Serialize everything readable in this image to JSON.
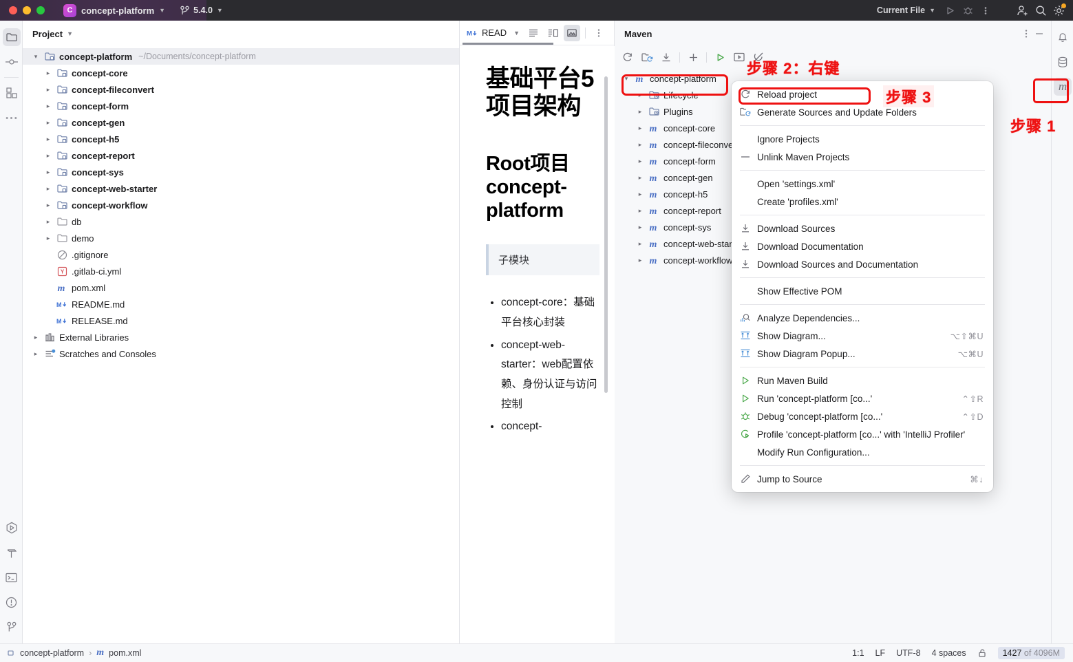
{
  "titlebar": {
    "project_name": "concept-platform",
    "project_badge": "C",
    "branch": "5.4.0",
    "run_config": "Current File",
    "icons": [
      "run-icon",
      "debug-icon",
      "more-options-icon",
      "add-user-icon",
      "search-icon",
      "settings-icon"
    ]
  },
  "left_activity_bar": {
    "items": [
      {
        "name": "project-tool-icon",
        "selected": true
      },
      {
        "name": "commit-tool-icon",
        "selected": false
      },
      {
        "name": "structure-tool-icon",
        "selected": false
      },
      {
        "name": "more-tools-icon",
        "selected": false
      }
    ],
    "bottom_items": [
      {
        "name": "run-tool-icon"
      },
      {
        "name": "build-tool-icon"
      },
      {
        "name": "terminal-tool-icon"
      },
      {
        "name": "problems-tool-icon"
      },
      {
        "name": "version-control-tool-icon"
      }
    ]
  },
  "project_panel": {
    "title": "Project",
    "tree": [
      {
        "label": "concept-platform",
        "path": "~/Documents/concept-platform",
        "icon": "module-folder-icon",
        "arrow": "open",
        "indent": 0,
        "bold": true,
        "selected": true
      },
      {
        "label": "concept-core",
        "icon": "module-folder-icon",
        "arrow": "closed",
        "indent": 1,
        "bold": true
      },
      {
        "label": "concept-fileconvert",
        "icon": "module-folder-icon",
        "arrow": "closed",
        "indent": 1,
        "bold": true
      },
      {
        "label": "concept-form",
        "icon": "module-folder-icon",
        "arrow": "closed",
        "indent": 1,
        "bold": true
      },
      {
        "label": "concept-gen",
        "icon": "module-folder-icon",
        "arrow": "closed",
        "indent": 1,
        "bold": true
      },
      {
        "label": "concept-h5",
        "icon": "module-folder-icon",
        "arrow": "closed",
        "indent": 1,
        "bold": true
      },
      {
        "label": "concept-report",
        "icon": "module-folder-icon",
        "arrow": "closed",
        "indent": 1,
        "bold": true
      },
      {
        "label": "concept-sys",
        "icon": "module-folder-icon",
        "arrow": "closed",
        "indent": 1,
        "bold": true
      },
      {
        "label": "concept-web-starter",
        "icon": "module-folder-icon",
        "arrow": "closed",
        "indent": 1,
        "bold": true
      },
      {
        "label": "concept-workflow",
        "icon": "module-folder-icon",
        "arrow": "closed",
        "indent": 1,
        "bold": true
      },
      {
        "label": "db",
        "icon": "folder-icon",
        "arrow": "closed",
        "indent": 1,
        "bold": false
      },
      {
        "label": "demo",
        "icon": "folder-icon",
        "arrow": "closed",
        "indent": 1,
        "bold": false
      },
      {
        "label": ".gitignore",
        "icon": "gitignore-icon",
        "arrow": "none",
        "indent": 1,
        "bold": false
      },
      {
        "label": ".gitlab-ci.yml",
        "icon": "yaml-icon",
        "arrow": "none",
        "indent": 1,
        "bold": false
      },
      {
        "label": "pom.xml",
        "icon": "maven-icon",
        "arrow": "none",
        "indent": 1,
        "bold": false
      },
      {
        "label": "README.md",
        "icon": "markdown-icon",
        "arrow": "none",
        "indent": 1,
        "bold": false
      },
      {
        "label": "RELEASE.md",
        "icon": "markdown-icon",
        "arrow": "none",
        "indent": 1,
        "bold": false
      },
      {
        "label": "External Libraries",
        "icon": "library-icon",
        "arrow": "closed",
        "indent": 0,
        "bold": false
      },
      {
        "label": "Scratches and Consoles",
        "icon": "scratches-icon",
        "arrow": "closed",
        "indent": 0,
        "bold": false
      }
    ]
  },
  "editor": {
    "tab_label": "READ",
    "tab_icon": "markdown-icon",
    "view_buttons": [
      {
        "name": "editor-only-view-button",
        "active": false
      },
      {
        "name": "split-view-button",
        "active": false
      },
      {
        "name": "preview-only-view-button",
        "active": true
      }
    ],
    "more_icon": "more-options-icon",
    "markdown": {
      "h1": "基础平台5项目架构",
      "h2": "Root项目 concept-platform",
      "quote": "子模块",
      "bullets": [
        "concept-core：基础平台核心封装",
        "concept-web-starter：web配置依赖、身份认证与访问控制",
        "concept-"
      ]
    }
  },
  "maven": {
    "title": "Maven",
    "header_icons": [
      "more-options-icon",
      "minimize-icon"
    ],
    "toolbar": [
      {
        "name": "reload-all-maven-projects-icon"
      },
      {
        "name": "generate-sources-icon"
      },
      {
        "name": "download-sources-icon"
      },
      {
        "name": "add-maven-project-icon"
      },
      {
        "name": "run-maven-build-icon"
      },
      {
        "name": "execute-maven-goal-icon"
      },
      {
        "name": "toggle-skip-tests-icon"
      }
    ],
    "tree": [
      {
        "label": "concept-platform",
        "icon": "maven-icon",
        "arrow": "open",
        "indent": 0,
        "highlighted": true
      },
      {
        "label": "Lifecycle",
        "icon": "maven-folder-icon",
        "arrow": "closed",
        "indent": 1
      },
      {
        "label": "Plugins",
        "icon": "maven-folder-icon",
        "arrow": "closed",
        "indent": 1
      },
      {
        "label": "concept-core",
        "icon": "maven-icon",
        "arrow": "closed",
        "indent": 1
      },
      {
        "label": "concept-fileconvert",
        "icon": "maven-icon",
        "arrow": "closed",
        "indent": 1
      },
      {
        "label": "concept-form",
        "icon": "maven-icon",
        "arrow": "closed",
        "indent": 1
      },
      {
        "label": "concept-gen",
        "icon": "maven-icon",
        "arrow": "closed",
        "indent": 1
      },
      {
        "label": "concept-h5",
        "icon": "maven-icon",
        "arrow": "closed",
        "indent": 1
      },
      {
        "label": "concept-report",
        "icon": "maven-icon",
        "arrow": "closed",
        "indent": 1
      },
      {
        "label": "concept-sys",
        "icon": "maven-icon",
        "arrow": "closed",
        "indent": 1
      },
      {
        "label": "concept-web-starter",
        "icon": "maven-icon",
        "arrow": "closed",
        "indent": 1
      },
      {
        "label": "concept-workflow",
        "icon": "maven-icon",
        "arrow": "closed",
        "indent": 1
      }
    ]
  },
  "right_activity_bar": {
    "items": [
      {
        "name": "notifications-icon",
        "selected": false
      },
      {
        "name": "database-icon",
        "selected": false
      },
      {
        "name": "maven-tool-icon",
        "selected": true
      }
    ]
  },
  "context_menu": {
    "items": [
      {
        "type": "item",
        "label": "Reload project",
        "icon": "reload-icon",
        "shortcut": "",
        "highlighted": true
      },
      {
        "type": "item",
        "label": "Generate Sources and Update Folders",
        "icon": "generate-sources-icon",
        "shortcut": ""
      },
      {
        "type": "separator"
      },
      {
        "type": "item",
        "label": "Ignore Projects",
        "icon": "",
        "shortcut": ""
      },
      {
        "type": "item",
        "label": "Unlink Maven Projects",
        "icon": "unlink-icon",
        "shortcut": ""
      },
      {
        "type": "separator"
      },
      {
        "type": "item",
        "label": "Open 'settings.xml'",
        "icon": "",
        "shortcut": ""
      },
      {
        "type": "item",
        "label": "Create 'profiles.xml'",
        "icon": "",
        "shortcut": ""
      },
      {
        "type": "separator"
      },
      {
        "type": "item",
        "label": "Download Sources",
        "icon": "download-icon",
        "shortcut": ""
      },
      {
        "type": "item",
        "label": "Download Documentation",
        "icon": "download-icon",
        "shortcut": ""
      },
      {
        "type": "item",
        "label": "Download Sources and Documentation",
        "icon": "download-icon",
        "shortcut": ""
      },
      {
        "type": "separator"
      },
      {
        "type": "item",
        "label": "Show Effective POM",
        "icon": "",
        "shortcut": ""
      },
      {
        "type": "separator"
      },
      {
        "type": "item",
        "label": "Analyze Dependencies...",
        "icon": "analyze-icon",
        "shortcut": ""
      },
      {
        "type": "item",
        "label": "Show Diagram...",
        "icon": "diagram-icon",
        "shortcut": "⌥⇧⌘U"
      },
      {
        "type": "item",
        "label": "Show Diagram Popup...",
        "icon": "diagram-icon",
        "shortcut": "⌥⌘U"
      },
      {
        "type": "separator"
      },
      {
        "type": "item",
        "label": "Run Maven Build",
        "icon": "run-icon",
        "shortcut": ""
      },
      {
        "type": "item",
        "label": "Run 'concept-platform [co...'",
        "icon": "run-icon",
        "shortcut": "⌃⇧R"
      },
      {
        "type": "item",
        "label": "Debug 'concept-platform [co...'",
        "icon": "debug-icon",
        "shortcut": "⌃⇧D"
      },
      {
        "type": "item",
        "label": "Profile 'concept-platform [co...' with 'IntelliJ Profiler'",
        "icon": "profile-icon",
        "shortcut": ""
      },
      {
        "type": "item",
        "label": "Modify Run Configuration...",
        "icon": "",
        "shortcut": ""
      },
      {
        "type": "separator"
      },
      {
        "type": "item",
        "label": "Jump to Source",
        "icon": "edit-icon",
        "shortcut": "⌘↓"
      }
    ]
  },
  "annotations": {
    "step1": "步骤 1",
    "step2": "步骤 2：右键",
    "step3": "步骤 3",
    "color": "#ee1111"
  },
  "statusbar": {
    "breadcrumb_project": "concept-platform",
    "breadcrumb_separator": "›",
    "breadcrumb_file": "pom.xml",
    "caret": "1:1",
    "line_separator": "LF",
    "encoding": "UTF-8",
    "indent": "4 spaces",
    "lock_icon": "read-only-toggle-icon",
    "memory_used": "1427",
    "memory_total": " of 4096M"
  }
}
